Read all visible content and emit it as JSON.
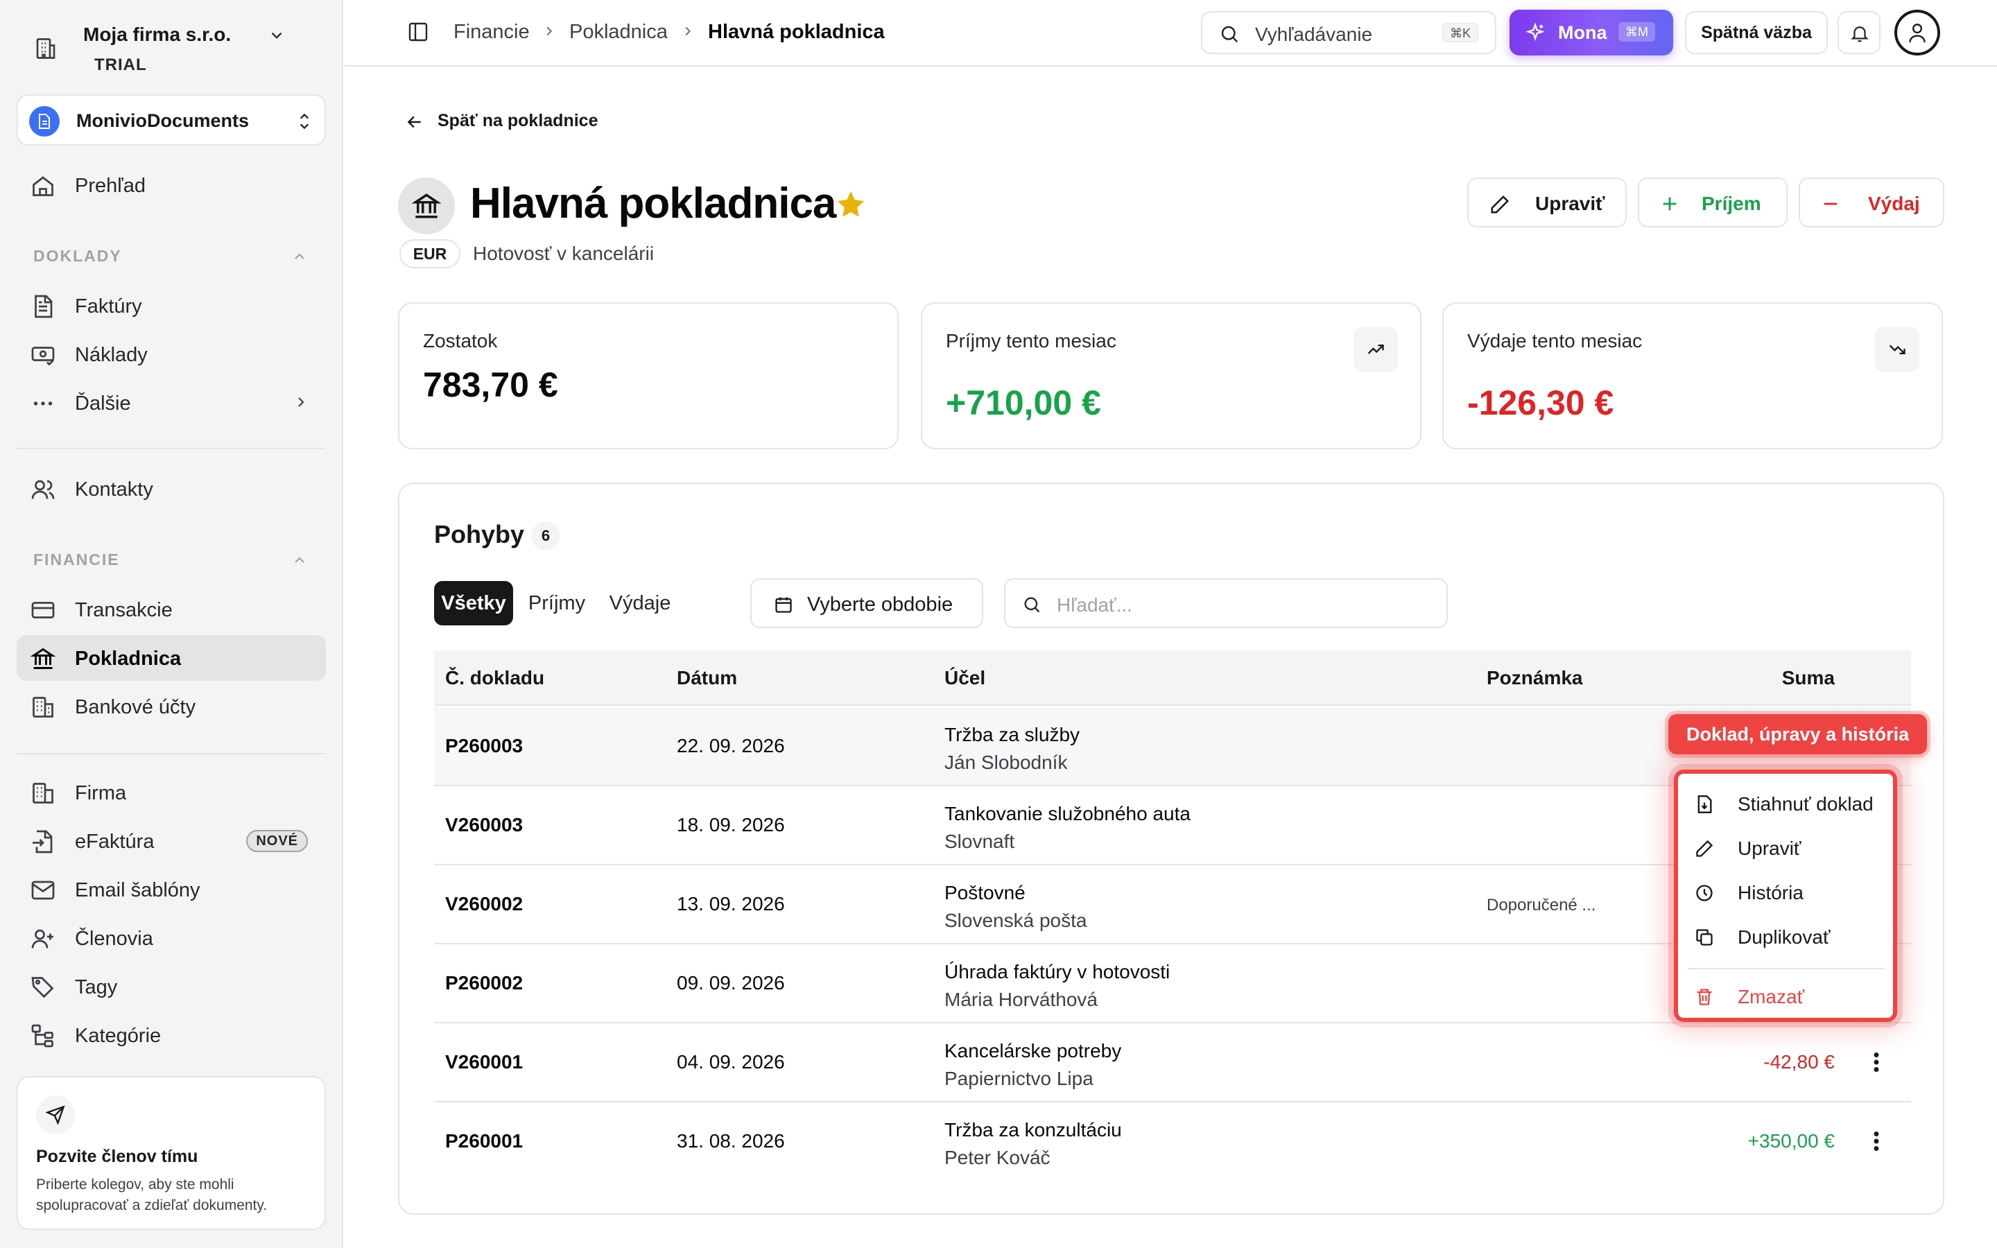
{
  "sidebar": {
    "company_name": "Moja firma s.r.o.",
    "plan": "TRIAL",
    "workspace": "MonivioDocuments",
    "overview": "Prehľad",
    "section_documents": "DOKLADY",
    "invoices": "Faktúry",
    "costs": "Náklady",
    "more": "Ďalšie",
    "contacts": "Kontakty",
    "section_finance": "FINANCIE",
    "transactions": "Transakcie",
    "cash_registers": "Pokladnica",
    "bank_accounts": "Bankové účty",
    "company": "Firma",
    "einvoice": "eFaktúra",
    "einvoice_badge": "NOVÉ",
    "email_templates": "Email šablóny",
    "members": "Členovia",
    "tags": "Tagy",
    "categories": "Kategórie",
    "invite_title": "Pozvite členov tímu",
    "invite_desc": "Priberte kolegov, aby ste mohli spolupracovať a zdieľať dokumenty."
  },
  "topbar": {
    "breadcrumb": [
      "Financie",
      "Pokladnica",
      "Hlavná pokladnica"
    ],
    "search_placeholder": "Vyhľadávanie",
    "search_shortcut": "⌘K",
    "assistant_label": "Mona",
    "assistant_shortcut": "⌘M",
    "feedback_label": "Spätná väzba"
  },
  "page": {
    "back_label": "Späť na pokladnice",
    "title": "Hlavná pokladnica",
    "currency": "EUR",
    "subtitle": "Hotovosť v kancelárii",
    "edit_label": "Upraviť",
    "income_label": "Príjem",
    "expense_label": "Výdaj"
  },
  "stats": {
    "balance_label": "Zostatok",
    "balance_value": "783,70 €",
    "income_label": "Príjmy tento mesiac",
    "income_value": "+710,00 €",
    "expense_label": "Výdaje tento mesiac",
    "expense_value": "-126,30 €"
  },
  "movements": {
    "title": "Pohyby",
    "count": "6",
    "tabs": [
      "Všetky",
      "Príjmy",
      "Výdaje"
    ],
    "period_label": "Vyberte obdobie",
    "search_placeholder": "Hľadať...",
    "columns": [
      "Č. dokladu",
      "Dátum",
      "Účel",
      "Poznámka",
      "Suma"
    ],
    "rows": [
      {
        "number": "P260003",
        "date": "22. 09. 2026",
        "purpose": "Tržba za služby",
        "party": "Ján Slobodník",
        "note": "",
        "amount": ""
      },
      {
        "number": "V260003",
        "date": "18. 09. 2026",
        "purpose": "Tankovanie služobného auta",
        "party": "Slovnaft",
        "note": "",
        "amount": ""
      },
      {
        "number": "V260002",
        "date": "13. 09. 2026",
        "purpose": "Poštovné",
        "party": "Slovenská pošta",
        "note": "Doporučené ...",
        "amount": ""
      },
      {
        "number": "P260002",
        "date": "09. 09. 2026",
        "purpose": "Úhrada faktúry v hotovosti",
        "party": "Mária Horváthová",
        "note": "",
        "amount": ""
      },
      {
        "number": "V260001",
        "date": "04. 09. 2026",
        "purpose": "Kancelárske potreby",
        "party": "Papiernictvo Lipa",
        "note": "",
        "amount": "-42,80 €"
      },
      {
        "number": "P260001",
        "date": "31. 08. 2026",
        "purpose": "Tržba za konzultáciu",
        "party": "Peter Kováč",
        "note": "",
        "amount": "+350,00 €"
      }
    ]
  },
  "context_menu": {
    "callout": "Doklad, úpravy a história",
    "items": [
      "Stiahnuť doklad",
      "Upraviť",
      "História",
      "Duplikovať",
      "Zmazať"
    ]
  },
  "colors": {
    "positive": "#16a34a",
    "negative": "#dc2626",
    "highlight": "#ef4444",
    "assistant": "#7c3aed",
    "favorite_star": "#eab308"
  }
}
